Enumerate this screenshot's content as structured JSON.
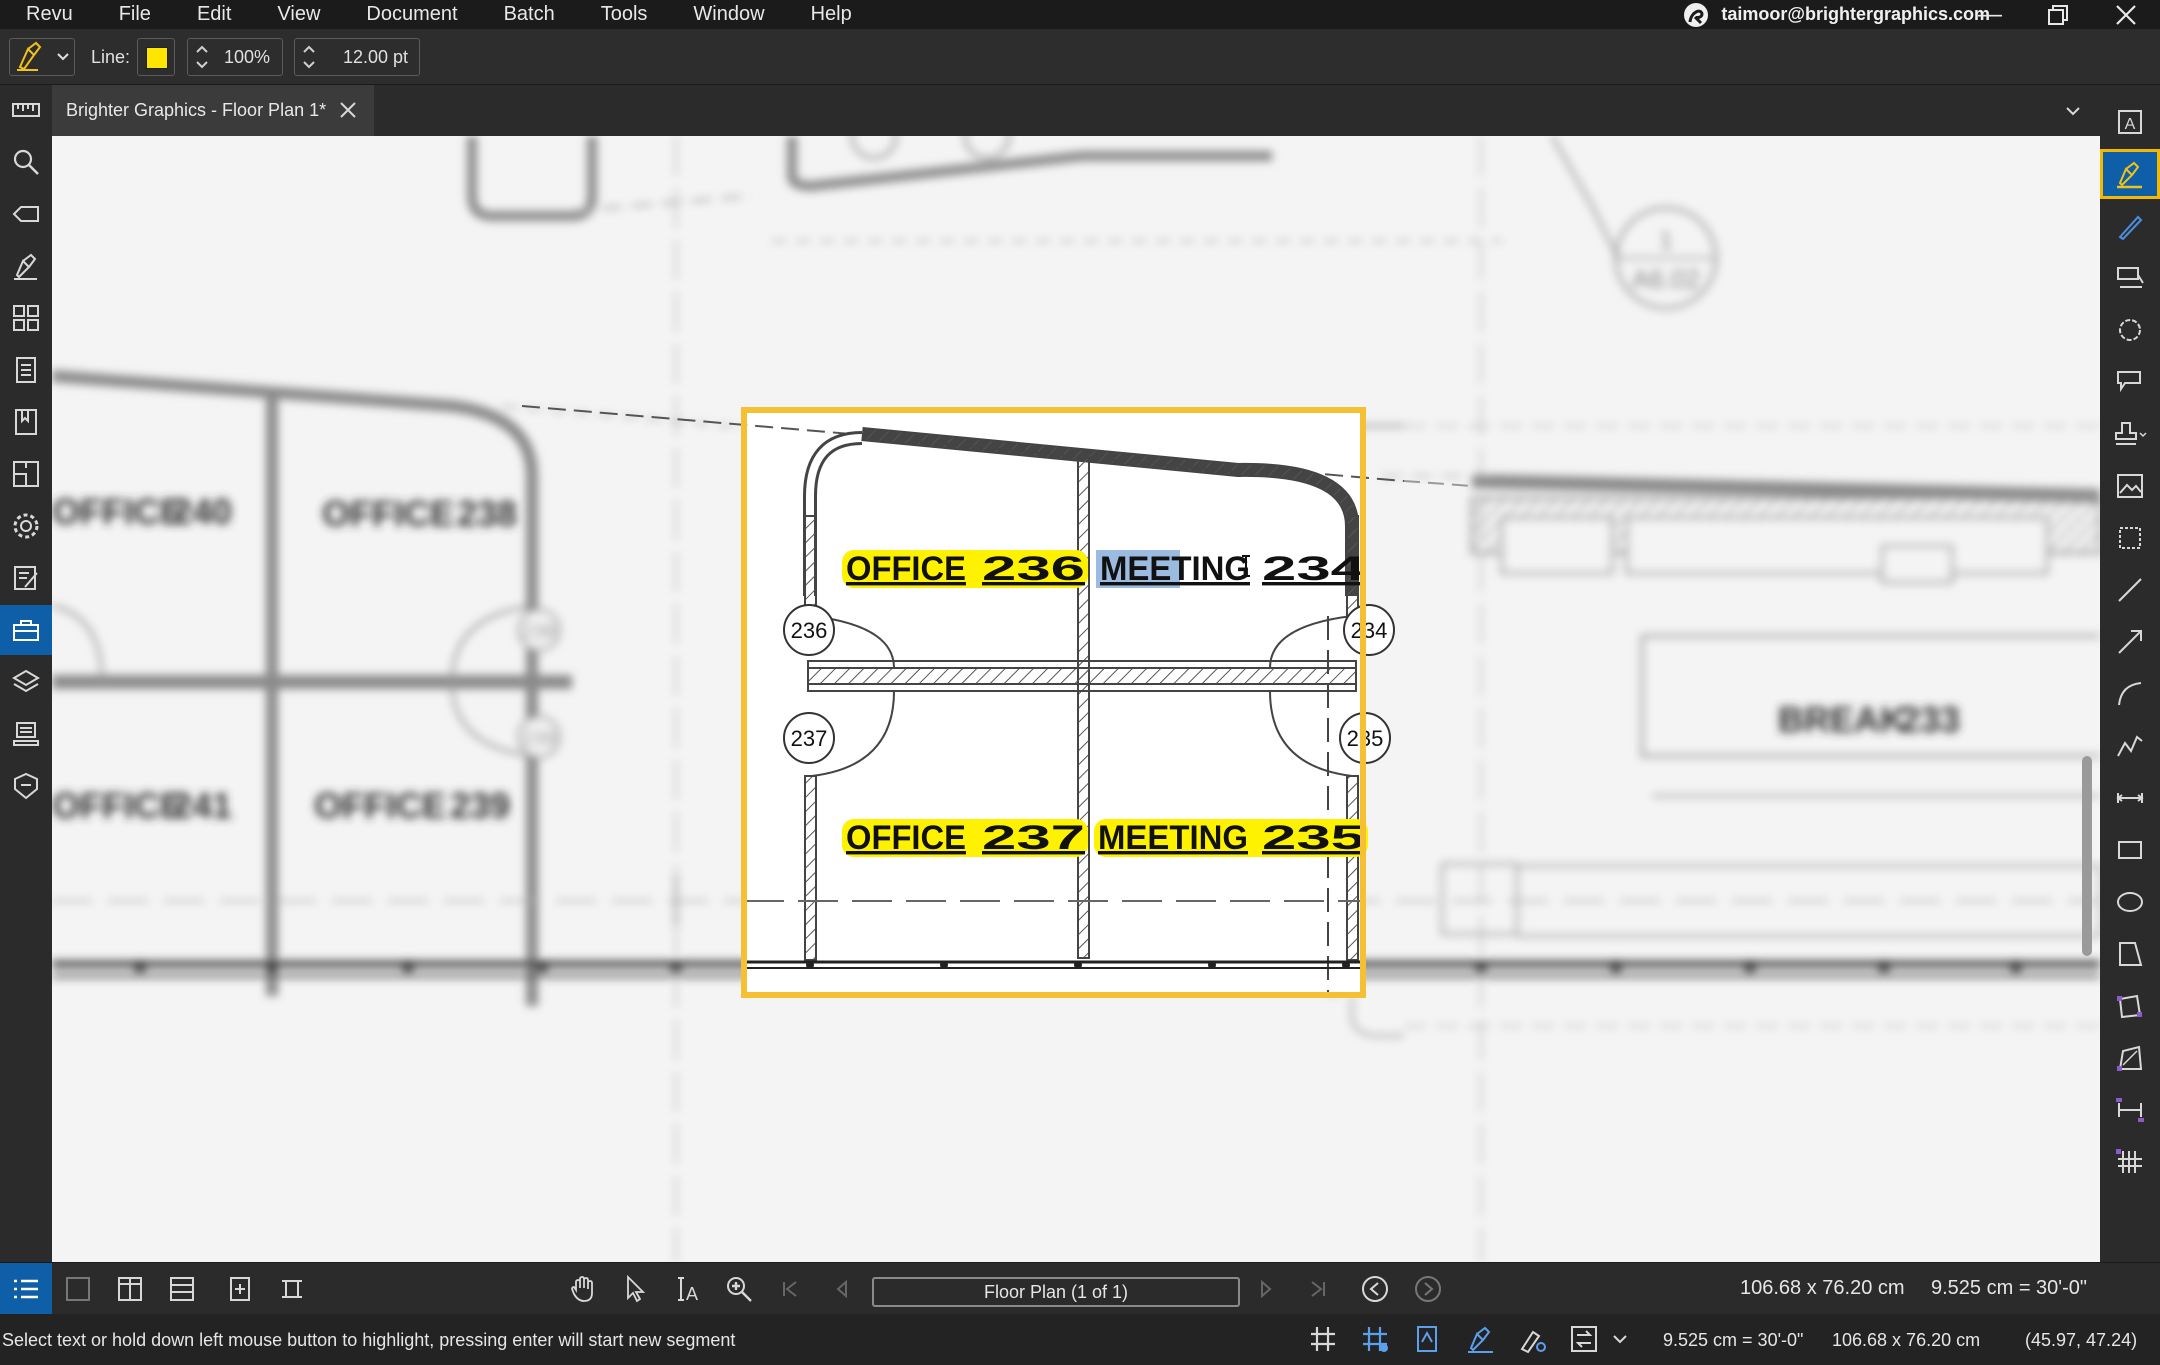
{
  "menubar": {
    "items": [
      "Revu",
      "File",
      "Edit",
      "View",
      "Document",
      "Batch",
      "Tools",
      "Window",
      "Help"
    ],
    "user_email": "taimoor@brightergraphics.com"
  },
  "toolbar": {
    "line_label": "Line:",
    "line_color": "#ffe600",
    "opacity": "100%",
    "width": "12.00 pt"
  },
  "tab": {
    "title": "Brighter Graphics - Floor Plan 1*"
  },
  "plan": {
    "rooms": [
      {
        "name": "OFFICE",
        "num": "236"
      },
      {
        "name": "MEETING",
        "num": "234"
      },
      {
        "name": "OFFICE",
        "num": "237"
      },
      {
        "name": "MEETING",
        "num": "235"
      }
    ],
    "door_tags": [
      "236",
      "237",
      "234",
      "235"
    ],
    "blurred_rooms": [
      {
        "name": "OFFICE",
        "num": "240"
      },
      {
        "name": "OFFICE",
        "num": "238"
      },
      {
        "name": "OFFICE",
        "num": "241"
      },
      {
        "name": "OFFICE",
        "num": "239"
      },
      {
        "name": "BREAK",
        "num": "233"
      }
    ],
    "blurred_tags": [
      "238",
      "239"
    ],
    "callout_top": "1",
    "callout_bottom": "A6.02",
    "highlight_color": "#fff200",
    "selection_color": "#9bbbe0",
    "frame_color": "#f5c033"
  },
  "navbar": {
    "page_label": "Floor Plan (1 of 1)",
    "page_size": "106.68 x 76.20 cm",
    "scale": "9.525 cm = 30'-0\""
  },
  "statusbar": {
    "hint": "Select text or hold down left mouse button to highlight, pressing enter will start new segment",
    "scale": "9.525 cm = 30'-0\"",
    "size": "106.68 x 76.20 cm",
    "coords": "(45.97, 47.24)"
  },
  "accent_blue": "#0e5fa8",
  "active_tool_outline": "#f5b800"
}
